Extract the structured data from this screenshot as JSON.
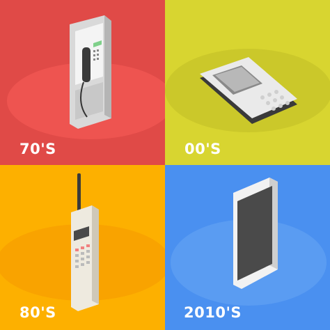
{
  "panels": [
    {
      "label": "70'S",
      "color": "#E04A47",
      "ellipse": "#EE5450",
      "device": "payphone"
    },
    {
      "label": "00'S",
      "color": "#D8D530",
      "ellipse": "#CBC82A",
      "device": "feature-phone"
    },
    {
      "label": "80'S",
      "color": "#FDB000",
      "ellipse": "#F9A300",
      "device": "brick-phone"
    },
    {
      "label": "2010'S",
      "color": "#4A90F0",
      "ellipse": "#5A9CF2",
      "device": "smartphone"
    }
  ]
}
